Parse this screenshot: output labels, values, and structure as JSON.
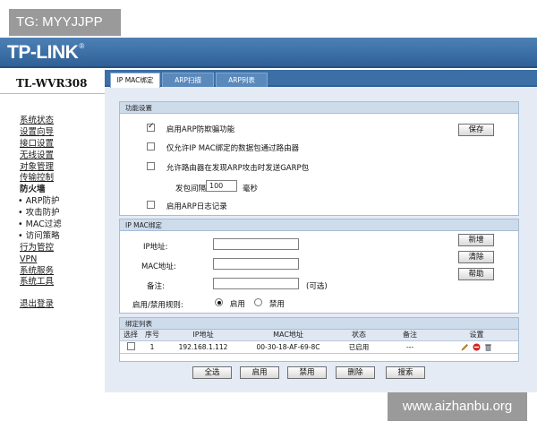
{
  "watermark_top": "TG: MYYJJPP",
  "watermark_bottom": "www.aizhanbu.org",
  "brand": {
    "logo": "TP-LINK",
    "mark": "®"
  },
  "model": "TL-WVR308",
  "sidebar": {
    "items": [
      {
        "label": "系统状态"
      },
      {
        "label": "设置向导"
      },
      {
        "label": "接口设置"
      },
      {
        "label": "无线设置"
      },
      {
        "label": "对象管理"
      },
      {
        "label": "传输控制"
      },
      {
        "label": "防火墙"
      },
      {
        "label": "• ARP防护"
      },
      {
        "label": "• 攻击防护"
      },
      {
        "label": "• MAC过滤"
      },
      {
        "label": "• 访问策略"
      },
      {
        "label": "行为管控"
      },
      {
        "label": "VPN"
      },
      {
        "label": "系统服务"
      },
      {
        "label": "系统工具"
      },
      {
        "label": "退出登录"
      }
    ]
  },
  "tabs": [
    {
      "label": "IP MAC绑定"
    },
    {
      "label": "ARP扫描"
    },
    {
      "label": "ARP列表"
    }
  ],
  "function_settings": {
    "title": "功能设置",
    "opt1": "启用ARP防欺骗功能",
    "opt2": "仅允许IP MAC绑定的数据包通过路由器",
    "opt3": "允许路由器在发现ARP攻击时发送GARP包",
    "interval_label": "发包间隔:",
    "interval_value": "100",
    "interval_unit": "毫秒",
    "opt4": "启用ARP日志记录",
    "save": "保存"
  },
  "binding": {
    "title": "IP MAC绑定",
    "ip_label": "IP地址:",
    "mac_label": "MAC地址:",
    "note_label": "备注:",
    "optional": "(可选)",
    "rule_label": "启用/禁用规则:",
    "enable": "启用",
    "disable": "禁用",
    "add": "新增",
    "clear": "清除",
    "help": "帮助"
  },
  "list": {
    "title": "绑定列表",
    "headers": [
      "选择",
      "序号",
      "IP地址",
      "MAC地址",
      "状态",
      "备注",
      "设置"
    ],
    "rows": [
      {
        "index": "1",
        "ip": "192.168.1.112",
        "mac": "00-30-18-AF-69-8C",
        "status": "已启用",
        "note": "---"
      }
    ]
  },
  "bottom_buttons": [
    "全选",
    "启用",
    "禁用",
    "删除",
    "搜索"
  ],
  "colors": {
    "header": "#3c6fa6",
    "content_bg": "#e4ebf5",
    "panel_title": "#cddbeb"
  }
}
